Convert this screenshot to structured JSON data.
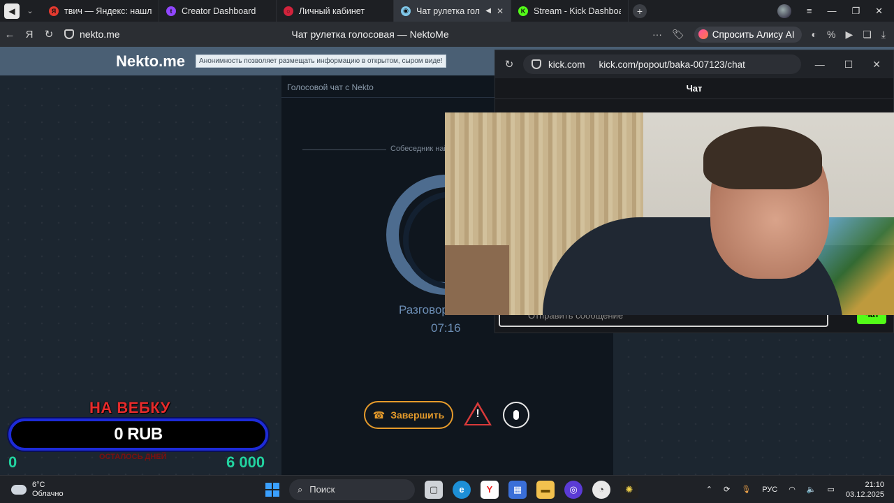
{
  "browser": {
    "tabs": [
      {
        "label": "твич — Яндекс: нашлось",
        "fav_color": "#e43a2f",
        "fav_glyph": "Я"
      },
      {
        "label": "Creator Dashboard",
        "fav_color": "#9146ff",
        "fav_glyph": "t"
      },
      {
        "label": "Личный кабинет",
        "fav_color": "#d2233c",
        "fav_glyph": "○"
      },
      {
        "label": "Чат рулетка голосовая",
        "fav_color": "#7fc6e8",
        "fav_glyph": "◉",
        "active": true
      },
      {
        "label": "Stream - Kick Dashboard",
        "fav_color": "#53fc18",
        "fav_glyph": "K"
      }
    ],
    "address": "nekto.me",
    "page_title": "Чат рулетка голосовая — NektoMe",
    "alice_label": "Спросить Алису AI"
  },
  "nekto": {
    "logo": "Nekto.me",
    "tagline": "Анонимность позволяет размещать информацию в открытом, сыром виде!",
    "panel_title": "Голосовой чат с Nekto",
    "separator_text": "Собеседник най",
    "conversation_label": "Разговор",
    "timer": "07:16",
    "end_button": "Завершить"
  },
  "donation": {
    "title": "НА ВЕБКУ",
    "amount": "0 RUB",
    "min": "0",
    "max": "6 000",
    "subtitle": "ОСТАЛОСЬ ДНЕЙ"
  },
  "popout": {
    "host": "kick.com",
    "url": "kick.com/popout/baka-007123/chat",
    "chat_title": "Чат",
    "input_placeholder": "Отправить сообщение",
    "send_label": "Чат"
  },
  "taskbar": {
    "temp": "6°C",
    "weather": "Облачно",
    "search": "Поиск",
    "lang": "РУС",
    "time": "21:10",
    "date": "03.12.2025"
  }
}
